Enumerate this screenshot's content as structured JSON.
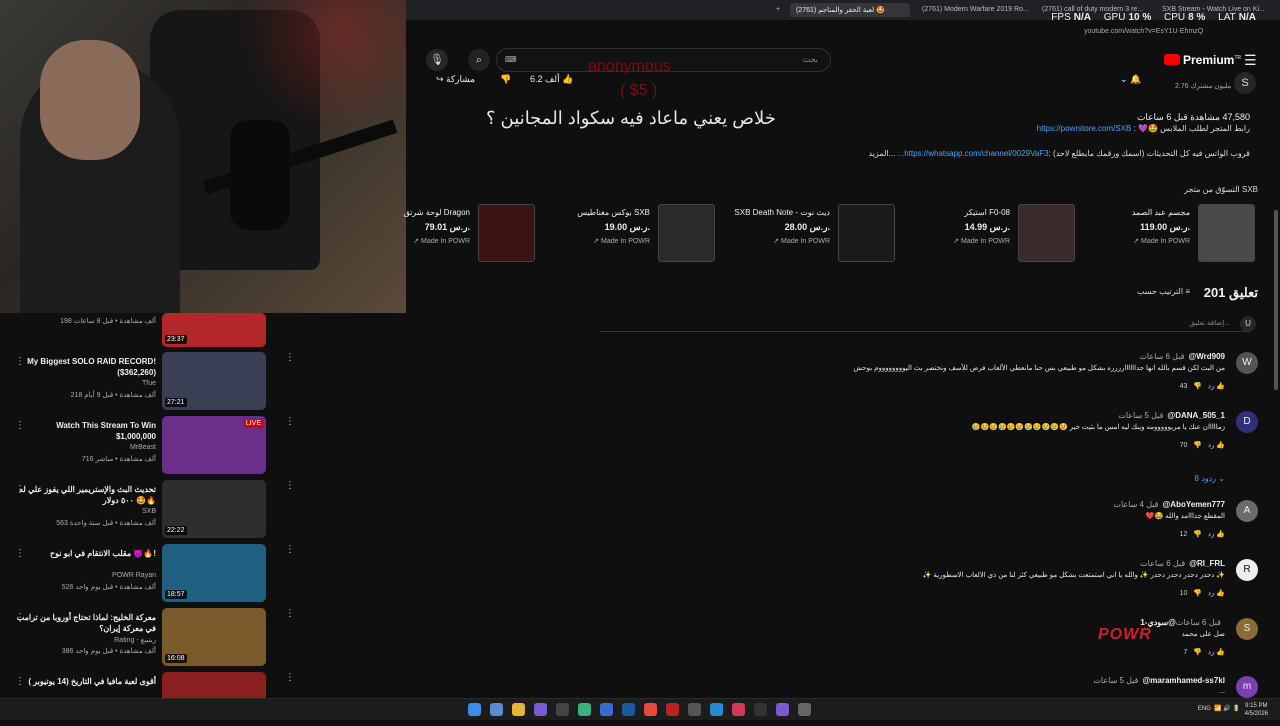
{
  "browser": {
    "tabs": [
      {
        "label": "+",
        "active": false
      },
      {
        "label": "(2761) لعبة الحفر والمناجم 🤩",
        "active": true
      },
      {
        "label": "(2761) Modern Warfare 2019 Ro...",
        "active": false
      },
      {
        "label": "(2761) call of duty modern 3 re...",
        "active": false
      },
      {
        "label": "SXB Stream - Watch Live on Ki...",
        "active": false
      }
    ],
    "url": "youtube.com/watch?v=EsY1U-EhmzQ",
    "stats": {
      "fps_label": "FPS",
      "fps": "N/A",
      "gpu_label": "GPU",
      "gpu": "10 %",
      "cpu_label": "CPU",
      "cpu": "8 %",
      "lat_label": "LAT",
      "lat": "N/A"
    }
  },
  "header": {
    "search_placeholder": "بحث",
    "premium_label": "Premium",
    "premium_sup": "TR"
  },
  "donation": {
    "name": "anonymous",
    "amount": "( $5 )",
    "message": "خلاص يعني ماعاد فيه سكواد المجانين ؟"
  },
  "video": {
    "likes": "6.2 ألف",
    "share": "مشاركة",
    "subs": "2.76 مليون مشترك",
    "views": "47,580 مشاهدة  قبل 6 ساعات",
    "desc_line1": "رابط المتجر لطلب الملابس 🤩💜 :",
    "desc_link1": "https://powrstore.com/SXB",
    "desc_line2": "قروب الواتس فيه كل التحديثات (اسمك ورقمك مايطلع لاحد) :",
    "desc_link2": "https://whatsapp.com/channel/0029VaF3...",
    "desc_more": "...المزيد"
  },
  "store": {
    "title": "التسوّق من متجر SXB",
    "made_in": "Made In POWR",
    "products": [
      {
        "name": "مجسم عبد الصمد",
        "price": "119.00 ر.س."
      },
      {
        "name": "استيكر F0-08",
        "price": "14.99 ر.س."
      },
      {
        "name": "SXB Death Note - ديث نوت",
        "price": "28.00 ر.س."
      },
      {
        "name": "بوكس مغناطيس SXB",
        "price": "19.00 ر.س."
      },
      {
        "name": "لوحة شرتق Dragon",
        "price": "79.01 ر.س."
      }
    ]
  },
  "comments": {
    "count": "201 تعليق",
    "sort_label": "الترتيب حسب",
    "add_placeholder": "إضافة تعليق...",
    "replies_label": "8 ردود",
    "reply_label": "رد",
    "items": [
      {
        "author": "@Wrd909",
        "time": "قبل 6 ساعات",
        "body": "من البث لكن قسم بالله انها جداااااارررره بشكل مو طبيعي بس حنا مانعطي الألعاب فرص للأسف ونختصر بث اليووووووووم بوحش",
        "likes": "43",
        "avatar": "W"
      },
      {
        "author": "@DANA_505_1",
        "time": "قبل 5 ساعات",
        "body": "زمااااان عنك يا مريووووومه وينك ليه امس ما بثيت خير 😢😢😢😢😢😢😢😢😢😢😢",
        "likes": "70",
        "avatar": "D"
      },
      {
        "author": "@AboYemen777",
        "time": "قبل 4 ساعات",
        "body": "المقطع جدااامد والله 😂❤️",
        "likes": "12",
        "avatar": "A"
      },
      {
        "author": "@RI_FRL",
        "time": "قبل 6 ساعات",
        "body": "✨ دحدر دحدر دحدر دحدر ✨ والله يا اني استمتعت بشكل مو طبيعي كثر لنا من ذي الالعاب الاسطورية ✨",
        "likes": "10",
        "avatar": "R"
      },
      {
        "author": "@سودي-1",
        "time": "قبل 6 ساعات",
        "body": "صل على محمد",
        "likes": "7",
        "avatar": "S"
      },
      {
        "author": "@maramhamed-ss7kl",
        "time": "قبل 5 ساعات",
        "body": "...",
        "likes": "",
        "avatar": "m"
      }
    ]
  },
  "sidebar": {
    "recs": [
      {
        "title": "",
        "channel": "",
        "meta": "198 ألف مشاهدة • قبل 8 ساعات",
        "duration": "23:37",
        "color": "#b3262a"
      },
      {
        "title": "My Biggest SOLO RAID RECORD! ($362,260)",
        "channel": "Tfue",
        "meta": "218 ألف مشاهدة • قبل 9 أيام",
        "duration": "27:21",
        "color": "#3b3f55"
      },
      {
        "title": "Watch This Stream To Win $1,000,000",
        "channel": "MrBeast",
        "meta": "716 ألف مشاهدة • مباشر",
        "duration": "LIVE",
        "color": "#6a2f8a"
      },
      {
        "title": "تحديث البث والإستريمير اللي يفوز علي له ٥٠٠ دولار 🤩🔥",
        "channel": "SXB",
        "meta": "563 ألف مشاهدة • قبل سنة واحدة",
        "duration": "22:22",
        "color": "#2e2e2e"
      },
      {
        "title": "مقلب الانتقام في ابو نوح 😈🔥!",
        "channel": "POWR Rayan",
        "meta": "526 ألف مشاهدة • قبل يوم واحد",
        "duration": "18:57",
        "color": "#1f5f7f"
      },
      {
        "title": "معركة الخليج: لماذا تحتاج أوروبا من ترامب في معركة إيران؟",
        "channel": "Rating - ريتينغ",
        "meta": "386 ألف مشاهدة • قبل يوم واحد",
        "duration": "16:08",
        "color": "#7a5a2a"
      },
      {
        "title": "أقوى لعبة مافيا في التاريخ (14 يوتيوبر )",
        "channel": "",
        "meta": "",
        "duration": "",
        "color": "#8a1f1f"
      }
    ]
  },
  "overlay": {
    "logo_text": "POWR"
  },
  "taskbar": {
    "lang": "ENG",
    "time": "9:15 PM",
    "date": "4/5/2026"
  }
}
